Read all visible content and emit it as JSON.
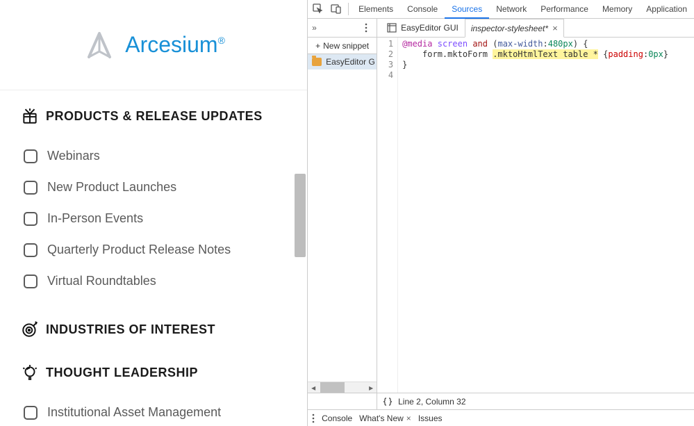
{
  "brand": {
    "name": "Arcesium"
  },
  "sections": [
    {
      "icon": "gift-icon",
      "title": "PRODUCTS & RELEASE UPDATES",
      "items": [
        "Webinars",
        "New Product Launches",
        "In-Person Events",
        "Quarterly Product Release Notes",
        "Virtual Roundtables"
      ]
    },
    {
      "icon": "target-icon",
      "title": "INDUSTRIES OF INTEREST",
      "items": []
    },
    {
      "icon": "lightbulb-icon",
      "title": "THOUGHT LEADERSHIP",
      "items": [
        "Institutional Asset Management"
      ]
    }
  ],
  "devtools": {
    "tabs": [
      "Elements",
      "Console",
      "Sources",
      "Network",
      "Performance",
      "Memory",
      "Application"
    ],
    "active_tab": "Sources",
    "nav_more_label": "»",
    "snippet_button": "New snippet",
    "file_tabs": [
      {
        "label": "EasyEditor GUI",
        "active": false,
        "dirty": false,
        "icon": "page-source-icon"
      },
      {
        "label": "inspector-stylesheet*",
        "active": true,
        "dirty": true
      }
    ],
    "sidebar_file": "EasyEditor G",
    "code": {
      "tokens": {
        "media_rule": "@media",
        "screen": "screen",
        "and": "and",
        "condition_prop": "max-width",
        "condition_val": "480px",
        "selector_plain_1": "form.mktoForm ",
        "selector_hl": ".mktoHtmlText table *",
        "prop": "padding",
        "val": "0px"
      },
      "lines": [
        "1",
        "2",
        "3",
        "4"
      ]
    },
    "status_text": "Line 2, Column 32",
    "drawer_tabs": [
      "Console",
      "What's New",
      "Issues"
    ]
  }
}
